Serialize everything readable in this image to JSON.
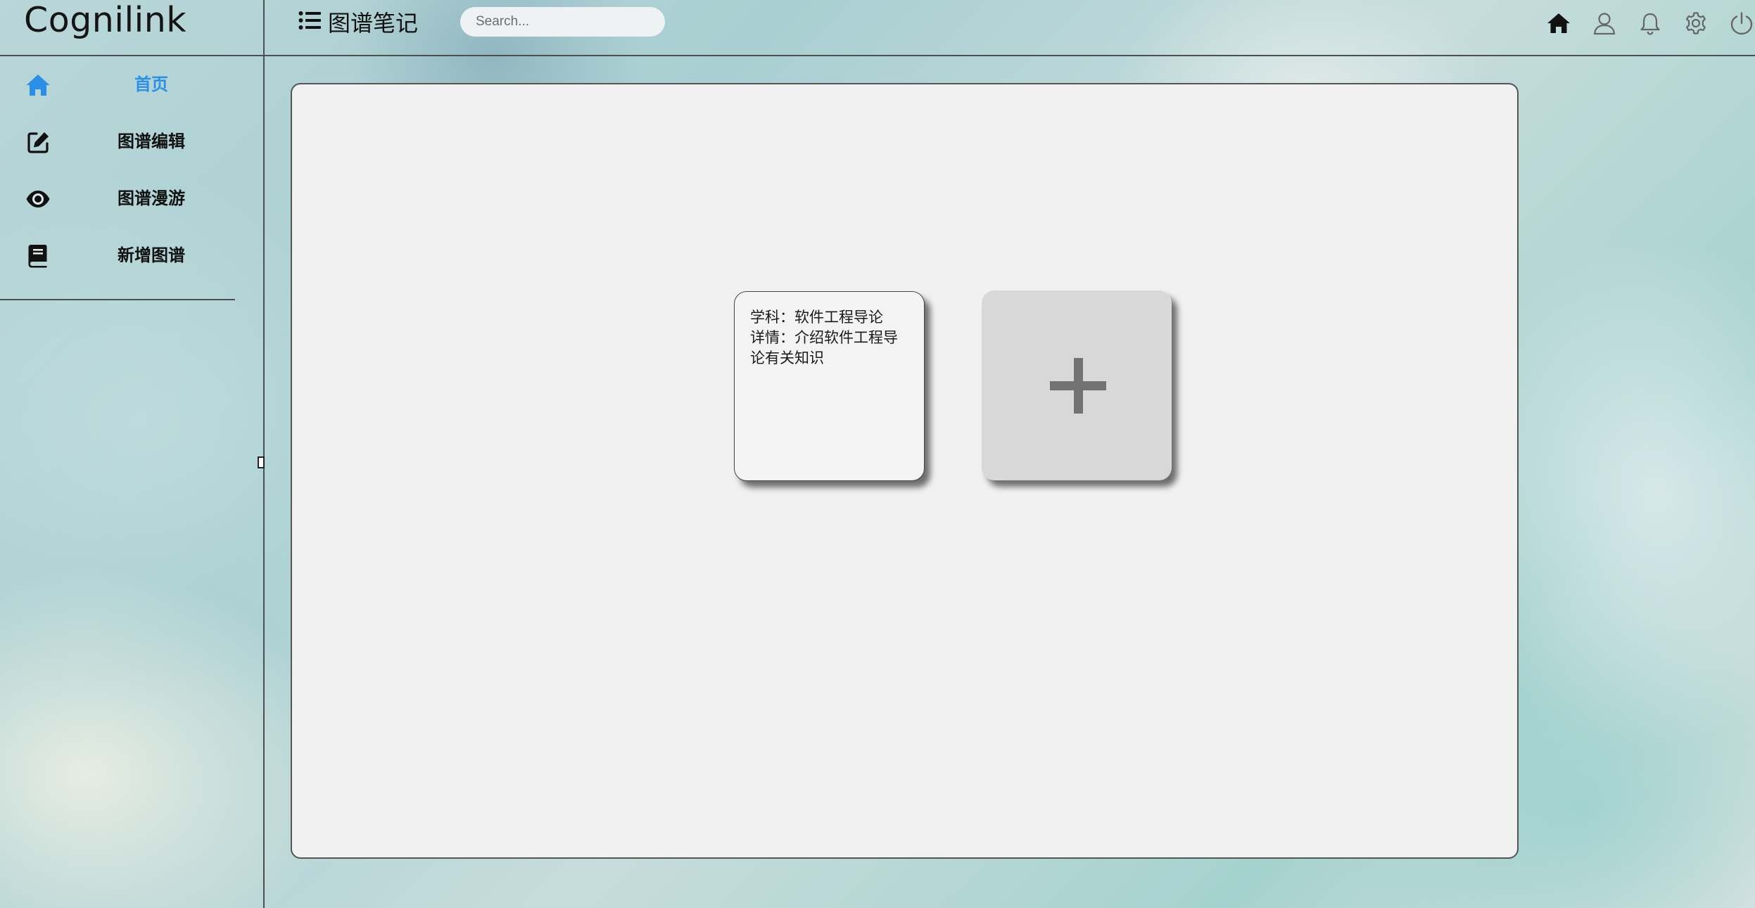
{
  "header": {
    "brand": "Cognilink",
    "page_heading": "图谱笔记",
    "search_placeholder": "Search...",
    "icons": [
      "home-icon",
      "user-icon",
      "bell-icon",
      "gear-icon",
      "power-icon"
    ]
  },
  "sidebar": {
    "items": [
      {
        "label": "首页",
        "icon": "home-icon",
        "active": true
      },
      {
        "label": "图谱编辑",
        "icon": "edit-icon",
        "active": false
      },
      {
        "label": "图谱漫游",
        "icon": "eye-icon",
        "active": false
      },
      {
        "label": "新增图谱",
        "icon": "book-icon",
        "active": false
      }
    ]
  },
  "main": {
    "cards": [
      {
        "subject": "学科：软件工程导论",
        "detail": "详情：介绍软件工程导论有关知识"
      }
    ],
    "add_card_icon": "plus-icon"
  },
  "colors": {
    "active_nav": "#2a8fe6",
    "panel_bg": "#f1f1f1",
    "add_card_bg": "#d8d8d8",
    "plus": "#727272"
  }
}
